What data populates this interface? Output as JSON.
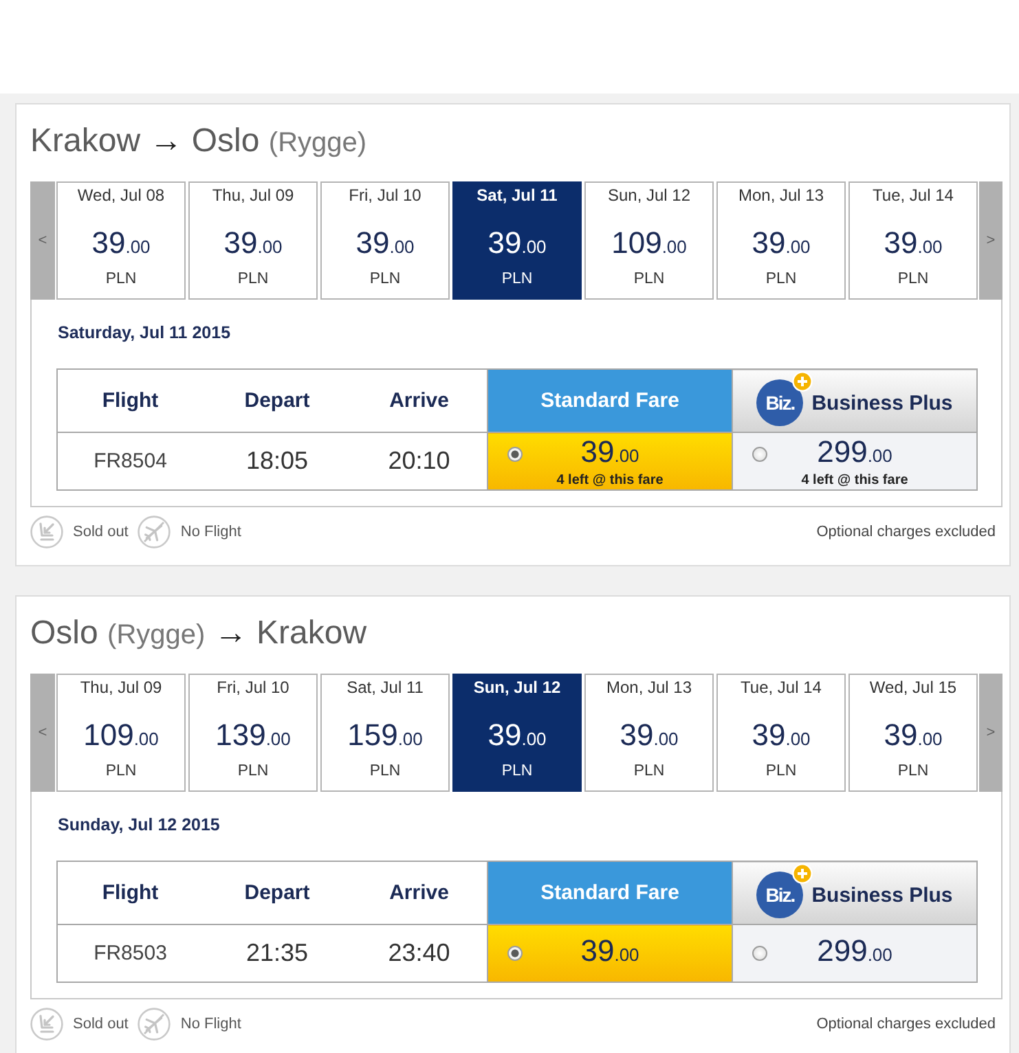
{
  "journeys": [
    {
      "title": [
        {
          "kind": "city",
          "text": "Krakow"
        },
        {
          "kind": "arrow",
          "text": "→"
        },
        {
          "kind": "city",
          "text": "Oslo"
        },
        {
          "kind": "airport",
          "text": "(Rygge)"
        }
      ],
      "date_strip": {
        "prev": "<",
        "next": ">",
        "dates": [
          {
            "label": "Wed, Jul 08",
            "amount": "39",
            "cents": ".00",
            "currency": "PLN",
            "selected": false
          },
          {
            "label": "Thu, Jul 09",
            "amount": "39",
            "cents": ".00",
            "currency": "PLN",
            "selected": false
          },
          {
            "label": "Fri, Jul 10",
            "amount": "39",
            "cents": ".00",
            "currency": "PLN",
            "selected": false
          },
          {
            "label": "Sat, Jul 11",
            "amount": "39",
            "cents": ".00",
            "currency": "PLN",
            "selected": true
          },
          {
            "label": "Sun, Jul 12",
            "amount": "109",
            "cents": ".00",
            "currency": "PLN",
            "selected": false
          },
          {
            "label": "Mon, Jul 13",
            "amount": "39",
            "cents": ".00",
            "currency": "PLN",
            "selected": false
          },
          {
            "label": "Tue, Jul 14",
            "amount": "39",
            "cents": ".00",
            "currency": "PLN",
            "selected": false
          }
        ]
      },
      "selected_date": "Saturday, Jul 11 2015",
      "table": {
        "columns": [
          "Flight",
          "Depart",
          "Arrive"
        ],
        "fares": [
          {
            "kind": "standard",
            "name": "Standard Fare"
          },
          {
            "kind": "business",
            "name": "Business Plus",
            "logo": "Biz."
          }
        ],
        "rows": [
          {
            "flight": "FR8504",
            "depart": "18:05",
            "arrive": "20:10",
            "prices": [
              {
                "amount": "39",
                "cents": ".00",
                "note": "4 left @ this fare",
                "selected": true
              },
              {
                "amount": "299",
                "cents": ".00",
                "note": "4 left @ this fare",
                "selected": false
              }
            ]
          }
        ]
      },
      "legend": [
        {
          "kind": "sold_out",
          "label": "Sold out"
        },
        {
          "kind": "no_flight",
          "label": "No Flight"
        }
      ],
      "footnote": "Optional charges excluded"
    },
    {
      "title": [
        {
          "kind": "city",
          "text": "Oslo"
        },
        {
          "kind": "airport",
          "text": "(Rygge)"
        },
        {
          "kind": "arrow",
          "text": "→"
        },
        {
          "kind": "city",
          "text": "Krakow"
        }
      ],
      "date_strip": {
        "prev": "<",
        "next": ">",
        "dates": [
          {
            "label": "Thu, Jul 09",
            "amount": "109",
            "cents": ".00",
            "currency": "PLN",
            "selected": false
          },
          {
            "label": "Fri, Jul 10",
            "amount": "139",
            "cents": ".00",
            "currency": "PLN",
            "selected": false
          },
          {
            "label": "Sat, Jul 11",
            "amount": "159",
            "cents": ".00",
            "currency": "PLN",
            "selected": false
          },
          {
            "label": "Sun, Jul 12",
            "amount": "39",
            "cents": ".00",
            "currency": "PLN",
            "selected": true
          },
          {
            "label": "Mon, Jul 13",
            "amount": "39",
            "cents": ".00",
            "currency": "PLN",
            "selected": false
          },
          {
            "label": "Tue, Jul 14",
            "amount": "39",
            "cents": ".00",
            "currency": "PLN",
            "selected": false
          },
          {
            "label": "Wed, Jul 15",
            "amount": "39",
            "cents": ".00",
            "currency": "PLN",
            "selected": false
          }
        ]
      },
      "selected_date": "Sunday, Jul 12 2015",
      "table": {
        "columns": [
          "Flight",
          "Depart",
          "Arrive"
        ],
        "fares": [
          {
            "kind": "standard",
            "name": "Standard Fare"
          },
          {
            "kind": "business",
            "name": "Business Plus",
            "logo": "Biz."
          }
        ],
        "rows": [
          {
            "flight": "FR8503",
            "depart": "21:35",
            "arrive": "23:40",
            "prices": [
              {
                "amount": "39",
                "cents": ".00",
                "selected": true
              },
              {
                "amount": "299",
                "cents": ".00",
                "selected": false
              }
            ]
          }
        ]
      },
      "legend": [
        {
          "kind": "sold_out",
          "label": "Sold out"
        },
        {
          "kind": "no_flight",
          "label": "No Flight"
        }
      ],
      "footnote": "Optional charges excluded"
    }
  ]
}
